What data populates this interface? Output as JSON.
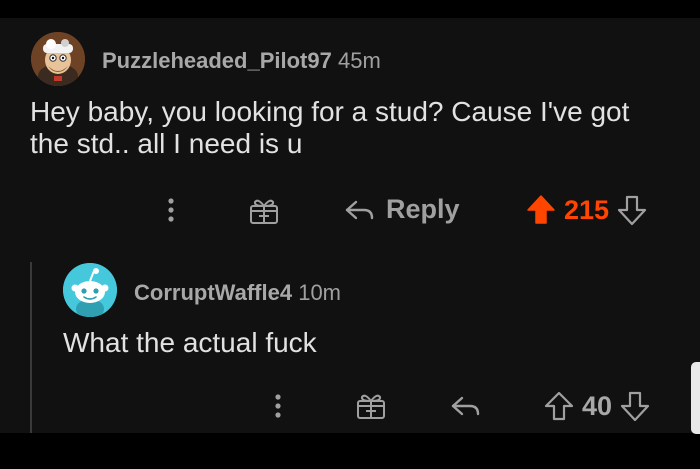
{
  "colors": {
    "upvote_active": "#ff4500",
    "score_active": "#ff4500",
    "text_primary": "#e2e2e2",
    "text_secondary": "#a8a8a8",
    "background": "#111111"
  },
  "comments": [
    {
      "username": "Puzzleheaded_Pilot97",
      "time": "45m",
      "body_lines": [
        "Hey baby, you looking for a stud? Cause I've got",
        "the std.. all I need is u"
      ],
      "actions": {
        "more_icon": "more-vertical-icon",
        "award_icon": "gift-icon",
        "reply_icon": "reply-arrow-icon",
        "reply_label": "Reply",
        "score": "215",
        "upvoted": true
      }
    },
    {
      "username": "CorruptWaffle4",
      "time": "10m",
      "body_lines": [
        "What the actual fuck"
      ],
      "actions": {
        "more_icon": "more-vertical-icon",
        "award_icon": "gift-icon",
        "reply_icon": "reply-arrow-icon",
        "score": "40",
        "upvoted": false
      }
    }
  ]
}
